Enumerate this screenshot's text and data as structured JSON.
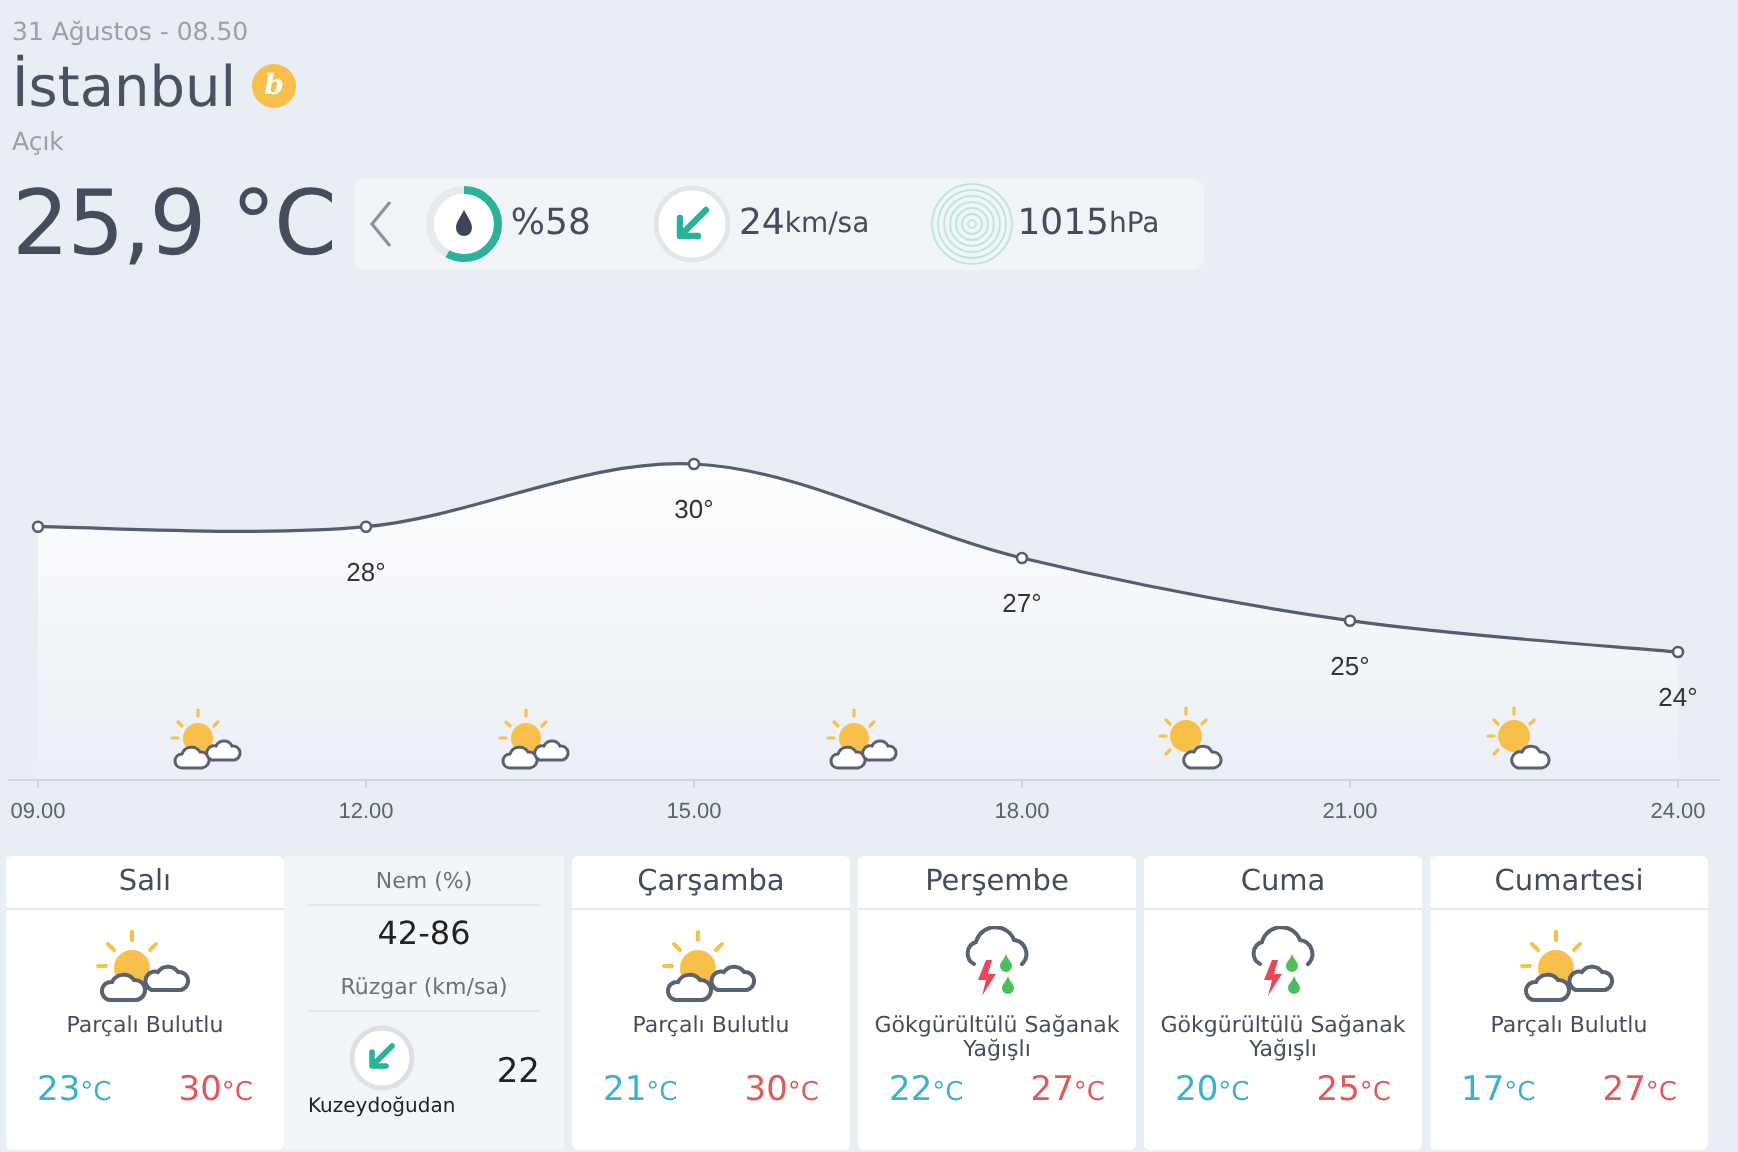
{
  "header": {
    "datetime": "31 Ağustos - 08.50",
    "city": "İstanbul",
    "badge": "b",
    "condition": "Açık",
    "temperature": "25,9 °C"
  },
  "stats": {
    "humidity": {
      "value": "%58",
      "level": 0.58
    },
    "wind": {
      "value": "24",
      "unit": "km/sa"
    },
    "pressure": {
      "value": "1015",
      "unit": "hPa"
    }
  },
  "hourly": {
    "chart_data": {
      "type": "area",
      "x": [
        "09.00",
        "12.00",
        "15.00",
        "18.00",
        "21.00",
        "24.00"
      ],
      "series": [
        {
          "color": "#555d6e",
          "values": [
            28,
            28,
            30,
            27,
            25,
            24
          ],
          "value_labels": [
            null,
            "28°",
            "30°",
            "27°",
            "25°",
            "24°"
          ]
        }
      ],
      "data_labels": true
    },
    "icons": [
      {
        "kind": "sun_two_clouds"
      },
      {
        "kind": "sun_two_clouds"
      },
      {
        "kind": "sun_two_clouds"
      },
      {
        "kind": "sun_cloud"
      },
      {
        "kind": "sun_cloud"
      }
    ]
  },
  "days": [
    {
      "day": "Salı",
      "kind": "partly_cloudy",
      "condition": "Parçalı Bulutlu",
      "low": "23",
      "low_unit": "°C",
      "high": "30",
      "high_unit": "°C",
      "expanded": true,
      "details": {
        "humidity_label": "Nem (%)",
        "humidity": "42-86",
        "wind_label": "Rüzgar (km/sa)",
        "wind_direction": "Kuzeydoğudan",
        "wind_speed": "22"
      }
    },
    {
      "day": "Çarşamba",
      "kind": "partly_cloudy",
      "condition": "Parçalı Bulutlu",
      "low": "21",
      "low_unit": "°C",
      "high": "30",
      "high_unit": "°C",
      "expanded": false
    },
    {
      "day": "Perşembe",
      "kind": "thunder_rain",
      "condition": "Gökgürültülü Sağanak Yağışlı",
      "low": "22",
      "low_unit": "°C",
      "high": "27",
      "high_unit": "°C",
      "expanded": false
    },
    {
      "day": "Cuma",
      "kind": "thunder_rain",
      "condition": "Gökgürültülü Sağanak Yağışlı",
      "low": "20",
      "low_unit": "°C",
      "high": "25",
      "high_unit": "°C",
      "expanded": false
    },
    {
      "day": "Cumartesi",
      "kind": "partly_cloudy",
      "condition": "Parçalı Bulutlu",
      "low": "17",
      "low_unit": "°C",
      "high": "27",
      "high_unit": "°C",
      "expanded": false
    }
  ]
}
